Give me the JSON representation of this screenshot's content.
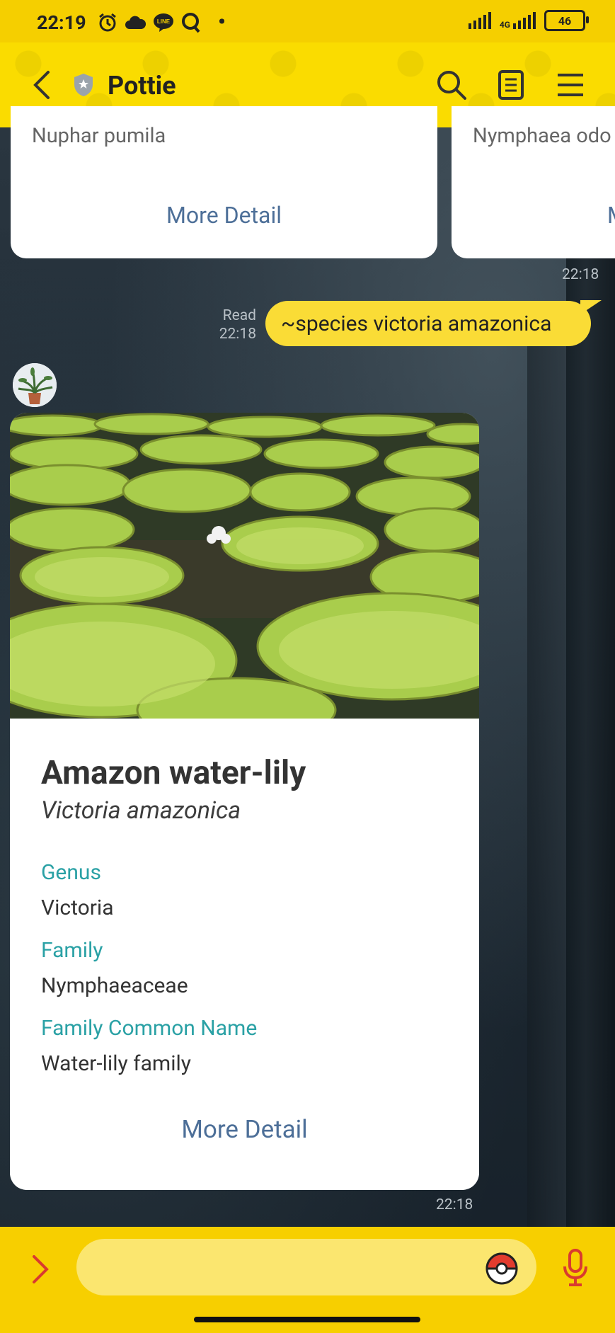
{
  "status_bar": {
    "time": "22:19",
    "battery": "46",
    "network": "4G"
  },
  "header": {
    "title": "Pottie"
  },
  "top_cards": [
    {
      "scientific_name": "Nuphar pumila",
      "more_label": "More Detail"
    },
    {
      "scientific_name": "Nymphaea odo",
      "more_label": "M"
    }
  ],
  "messages": {
    "top_cards_time": "22:18",
    "outgoing": {
      "read_label": "Read",
      "time": "22:18",
      "text": "~species victoria amazonica"
    },
    "species_card": {
      "common_name": "Amazon water-lily",
      "scientific_name": "Victoria amazonica",
      "fields": [
        {
          "label": "Genus",
          "value": "Victoria"
        },
        {
          "label": "Family",
          "value": "Nymphaeaceae"
        },
        {
          "label": "Family Common Name",
          "value": "Water-lily family"
        }
      ],
      "more_label": "More Detail",
      "time": "22:18"
    }
  },
  "input": {
    "placeholder": ""
  },
  "colors": {
    "header_yellow": "#fadc00",
    "bubble_yellow": "#fadc36",
    "label_teal": "#2aa1a5",
    "link_blue": "#4d6f98"
  }
}
